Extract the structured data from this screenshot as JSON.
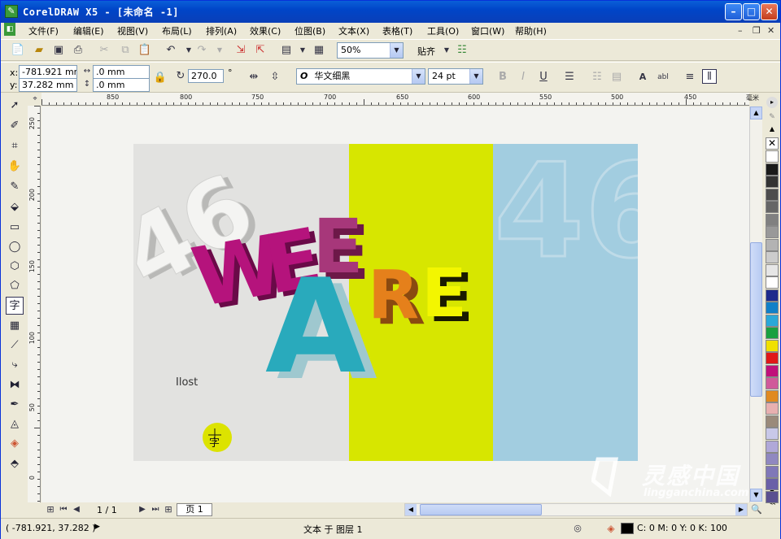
{
  "window": {
    "title": "CorelDRAW X5 - [未命名 -1]",
    "app_icon": "coreldraw-icon"
  },
  "menu": {
    "items": [
      "文件(F)",
      "编辑(E)",
      "视图(V)",
      "布局(L)",
      "排列(A)",
      "效果(C)",
      "位图(B)",
      "文本(X)",
      "表格(T)",
      "工具(O)",
      "窗口(W)",
      "帮助(H)"
    ]
  },
  "standard_toolbar": {
    "zoom": "50%",
    "snap_label": "贴齐"
  },
  "property_bar": {
    "x_label": "x:",
    "y_label": "y:",
    "x_value": "-781.921 mm",
    "y_value": "37.282 mm",
    "width_value": ".0 mm",
    "height_value": ".0 mm",
    "angle_value": "270.0",
    "angle_unit": "°",
    "font_name": "华文细黑",
    "font_glyph": "O",
    "font_size": "24 pt"
  },
  "rulers": {
    "horizontal_ticks": [
      "850",
      "800",
      "750",
      "700",
      "650",
      "600",
      "550",
      "500",
      "450"
    ],
    "horizontal_unit": "毫米",
    "vertical_ticks": [
      "250",
      "200",
      "150",
      "100",
      "50",
      "0"
    ]
  },
  "artwork": {
    "background_colors": {
      "left": "#e2e2e0",
      "middle": "#d7e600",
      "right": "#a2cde0"
    },
    "numeral_text": "46",
    "word_we": [
      "W",
      "E"
    ],
    "word_are": [
      "A",
      "R",
      "E"
    ],
    "letter_e_top": "E",
    "ilost_text": "Ilost",
    "char_text": "字",
    "colors": {
      "magenta": "#b5137c",
      "purple": "#a7377a",
      "teal": "#29aabc",
      "orange": "#e5801b",
      "yellow": "#f3f600",
      "yellow_badge": "#dce300"
    }
  },
  "navigation": {
    "page_indicator": "1 / 1",
    "page_tab": "页 1"
  },
  "status_bar": {
    "coordinates": "( -781.921, 37.282 )",
    "layer_info": "文本 于 图层 1",
    "color_info": "C: 0 M: 0 Y: 0 K: 100"
  },
  "watermark": {
    "brand_cn": "灵感中国",
    "brand_url": "lingganchina.com"
  },
  "palette_colors": [
    "#ffffff",
    "#1a1a1a",
    "#333333",
    "#4d4d4d",
    "#666666",
    "#808080",
    "#999999",
    "#b3b3b3",
    "#cccccc",
    "#e6e6e6",
    "#ffffff",
    "#1d2a8c",
    "#1080c8",
    "#2aa8d8",
    "#19a040",
    "#f0e000",
    "#e01818",
    "#c0107a",
    "#d05a9a",
    "#e08a20",
    "#e8b0b0",
    "#9a8a7a",
    "#c8c8e8",
    "#b0a8d8",
    "#9088c0",
    "#8078b8",
    "#6a60a8",
    "#5a5090"
  ]
}
